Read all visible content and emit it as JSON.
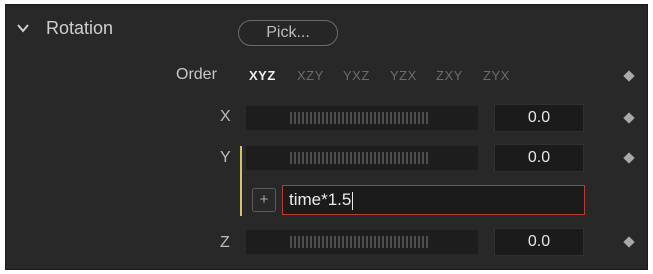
{
  "header": {
    "section_title": "Rotation",
    "pick_label": "Pick...",
    "expanded_icon": "chevron-down-icon"
  },
  "order": {
    "label": "Order",
    "options": [
      "XYZ",
      "XZY",
      "YXZ",
      "YZX",
      "ZXY",
      "ZYX"
    ],
    "selected": "XYZ"
  },
  "axes": {
    "x": {
      "label": "X",
      "value": "0.0"
    },
    "y": {
      "label": "Y",
      "value": "0.0"
    },
    "z": {
      "label": "Z",
      "value": "0.0"
    }
  },
  "expression": {
    "add_label": "+",
    "value": "time*1.5"
  },
  "colors": {
    "panel_bg": "#282828",
    "expression_border": "#b83a30",
    "expression_indicator": "#d5c36b",
    "keyframe_diamond": "#a9a9a9"
  },
  "icons": {
    "keyframe": "diamond-icon",
    "slider_ticks": "tick-marks"
  }
}
